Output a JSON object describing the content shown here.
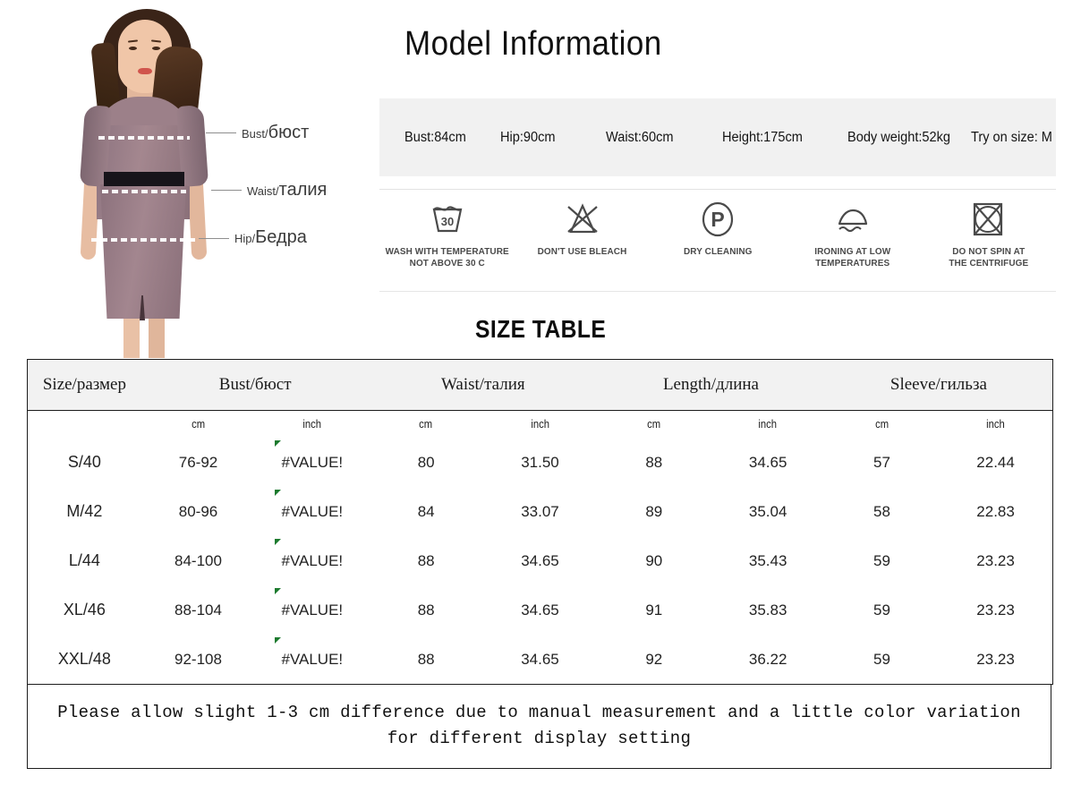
{
  "model_section": {
    "title": "Model Information",
    "stats": [
      "Bust:84cm",
      "Hip:90cm",
      "Waist:60cm",
      "Height:175cm",
      "Body weight:52kg",
      "Try on size: M"
    ]
  },
  "photo_labels": [
    {
      "en": "Bust/",
      "ru": "бюст"
    },
    {
      "en": "Waist/",
      "ru": "талия"
    },
    {
      "en": "Hip/",
      "ru": "Бедра"
    }
  ],
  "care_symbols": [
    {
      "icon": "wash-30-basin-icon",
      "label": "WASH WITH TEMPERATURE\nNOT ABOVE 30 C",
      "value": "30"
    },
    {
      "icon": "no-bleach-triangle-icon",
      "label": "DON'T USE BLEACH"
    },
    {
      "icon": "dry-clean-p-circle-icon",
      "label": "DRY CLEANING",
      "value": "P"
    },
    {
      "icon": "iron-low-temp-icon",
      "label": "IRONING AT LOW\nTEMPERATURES"
    },
    {
      "icon": "no-spin-centrifuge-icon",
      "label": "DO NOT SPIN AT\nTHE CENTRIFUGE"
    }
  ],
  "size_table": {
    "title": "SIZE TABLE",
    "group_headers": [
      "Size/размер",
      "Bust/бюст",
      "Waist/талия",
      "Length/длина",
      "Sleeve/гильза"
    ],
    "unit_headers": [
      "",
      "cm",
      "inch",
      "cm",
      "inch",
      "cm",
      "inch",
      "cm",
      "inch"
    ],
    "rows": [
      {
        "size": "S/40",
        "bust_cm": "76-92",
        "bust_inch": "#VALUE!",
        "waist_cm": "80",
        "waist_inch": "31.50",
        "length_cm": "88",
        "length_inch": "34.65",
        "sleeve_cm": "57",
        "sleeve_inch": "22.44"
      },
      {
        "size": "M/42",
        "bust_cm": "80-96",
        "bust_inch": "#VALUE!",
        "waist_cm": "84",
        "waist_inch": "33.07",
        "length_cm": "89",
        "length_inch": "35.04",
        "sleeve_cm": "58",
        "sleeve_inch": "22.83"
      },
      {
        "size": "L/44",
        "bust_cm": "84-100",
        "bust_inch": "#VALUE!",
        "waist_cm": "88",
        "waist_inch": "34.65",
        "length_cm": "90",
        "length_inch": "35.43",
        "sleeve_cm": "59",
        "sleeve_inch": "23.23"
      },
      {
        "size": "XL/46",
        "bust_cm": "88-104",
        "bust_inch": "#VALUE!",
        "waist_cm": "88",
        "waist_inch": "34.65",
        "length_cm": "91",
        "length_inch": "35.83",
        "sleeve_cm": "59",
        "sleeve_inch": "23.23"
      },
      {
        "size": "XXL/48",
        "bust_cm": "92-108",
        "bust_inch": "#VALUE!",
        "waist_cm": "88",
        "waist_inch": "34.65",
        "length_cm": "92",
        "length_inch": "36.22",
        "sleeve_cm": "59",
        "sleeve_inch": "23.23"
      }
    ]
  },
  "footer_note": "Please allow slight 1-3 cm difference due to manual measurement and a little color variation for different display setting",
  "colors": {
    "stats_bar_bg": "#f1f1f1",
    "table_header_bg": "#f2f2f2",
    "table_border": "#1d1d1d",
    "care_icon": "#4a4a4a",
    "error_flag_green": "#1c7a2e",
    "dress": "#8d7480"
  }
}
